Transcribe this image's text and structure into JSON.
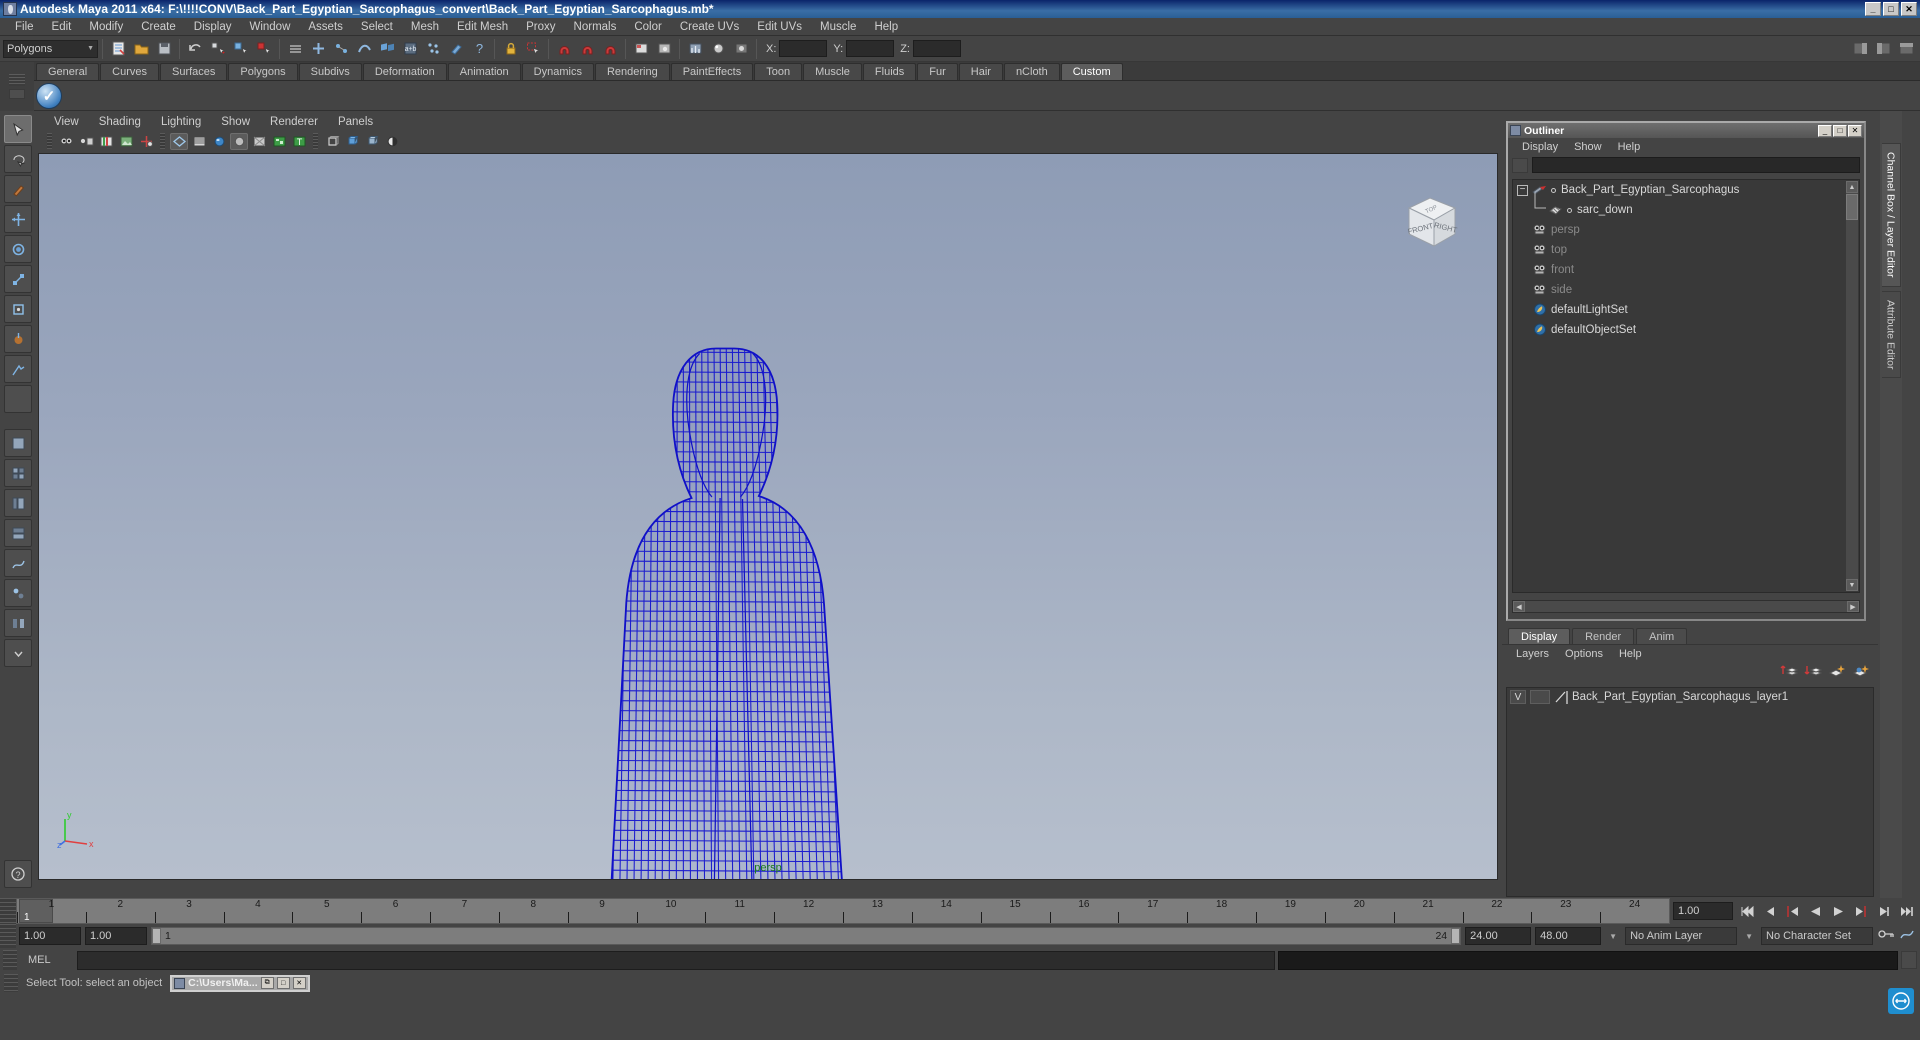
{
  "window": {
    "title": "Autodesk Maya 2011 x64: F:\\!!!!CONV\\Back_Part_Egyptian_Sarcophagus_convert\\Back_Part_Egyptian_Sarcophagus.mb*",
    "minimize": "_",
    "maximize": "□",
    "close": "✕",
    "app_icon": "maya-icon"
  },
  "menubar": {
    "items": [
      "File",
      "Edit",
      "Modify",
      "Create",
      "Display",
      "Window",
      "Assets",
      "Select",
      "Mesh",
      "Edit Mesh",
      "Proxy",
      "Normals",
      "Color",
      "Create UVs",
      "Edit UVs",
      "Muscle",
      "Help"
    ]
  },
  "toolbar": {
    "menu_set": "Polygons",
    "menu_set_arrow": "▼",
    "coords": [
      {
        "label": "X:",
        "value": ""
      },
      {
        "label": "Y:",
        "value": ""
      },
      {
        "label": "Z:",
        "value": ""
      }
    ]
  },
  "shelf": {
    "tabs": [
      "General",
      "Curves",
      "Surfaces",
      "Polygons",
      "Subdivs",
      "Deformation",
      "Animation",
      "Dynamics",
      "Rendering",
      "PaintEffects",
      "Toon",
      "Muscle",
      "Fluids",
      "Fur",
      "Hair",
      "nCloth",
      "Custom"
    ],
    "active_tab": "Custom"
  },
  "viewport": {
    "menus": [
      "View",
      "Shading",
      "Lighting",
      "Show",
      "Renderer",
      "Panels"
    ],
    "camera_label": "persp",
    "viewcube": {
      "front": "FRONT",
      "right": "RIGHT",
      "top": "TOP"
    },
    "axis": {
      "x": "x",
      "y": "y",
      "z": "z"
    }
  },
  "outliner": {
    "title": "Outliner",
    "window_buttons": {
      "minimize": "_",
      "maximize": "□",
      "close": "✕"
    },
    "menus": [
      "Display",
      "Show",
      "Help"
    ],
    "search_value": "",
    "items": [
      {
        "label": "Back_Part_Egyptian_Sarcophagus",
        "icon": "transform-icon",
        "depth": 0,
        "expanded": true,
        "dim": false
      },
      {
        "label": "sarc_down",
        "icon": "mesh-icon",
        "depth": 1,
        "expanded": false,
        "dim": false
      },
      {
        "label": "persp",
        "icon": "camera-icon",
        "depth": 0,
        "expanded": false,
        "dim": true
      },
      {
        "label": "top",
        "icon": "camera-icon",
        "depth": 0,
        "expanded": false,
        "dim": true
      },
      {
        "label": "front",
        "icon": "camera-icon",
        "depth": 0,
        "expanded": false,
        "dim": true
      },
      {
        "label": "side",
        "icon": "camera-icon",
        "depth": 0,
        "expanded": false,
        "dim": true
      },
      {
        "label": "defaultLightSet",
        "icon": "set-icon",
        "depth": 0,
        "expanded": false,
        "dim": false
      },
      {
        "label": "defaultObjectSet",
        "icon": "set-icon",
        "depth": 0,
        "expanded": false,
        "dim": false
      }
    ]
  },
  "layer_editor": {
    "tabs": [
      "Display",
      "Render",
      "Anim"
    ],
    "active_tab": "Display",
    "menus": [
      "Layers",
      "Options",
      "Help"
    ],
    "layers": [
      {
        "visibility": "V",
        "display_type": "",
        "name": "Back_Part_Egyptian_Sarcophagus_layer1"
      }
    ]
  },
  "side_tabs": {
    "items": [
      "Channel Box / Layer Editor",
      "Attribute Editor"
    ],
    "active": "Channel Box / Layer Editor"
  },
  "timeline": {
    "ticks": [
      1,
      2,
      3,
      4,
      5,
      6,
      7,
      8,
      9,
      10,
      11,
      12,
      13,
      14,
      15,
      16,
      17,
      18,
      19,
      20,
      21,
      22,
      23,
      24
    ],
    "current_frame": "1",
    "range_start": "1.00",
    "range_step": "1.00",
    "playback_start": "1",
    "playback_end": "24",
    "anim_end": "24.00",
    "anim_total": "48.00",
    "current_time": "1.00",
    "anim_layer": "No Anim Layer",
    "character_set": "No Character Set",
    "playback_buttons": [
      "go-to-start-icon",
      "step-back-frame-icon",
      "step-back-key-icon",
      "play-backwards-icon",
      "play-forwards-icon",
      "step-forward-key-icon",
      "step-forward-frame-icon",
      "go-to-end-icon"
    ]
  },
  "command_line": {
    "language": "MEL",
    "command_value": "",
    "output_value": ""
  },
  "status_bar": {
    "help_text": "Select Tool: select an object",
    "taskbar_window": {
      "title": "C:\\Users\\Ma...",
      "restore": "⧉",
      "maximize": "□",
      "close": "✕"
    }
  },
  "colors": {
    "title_bar_blue": "#0a246a",
    "wireframe_blue": "#1a1ad0",
    "viewport_sky": "#9aa6bd",
    "panel_gray": "#444444",
    "accent_green": "#1b7a1b"
  }
}
